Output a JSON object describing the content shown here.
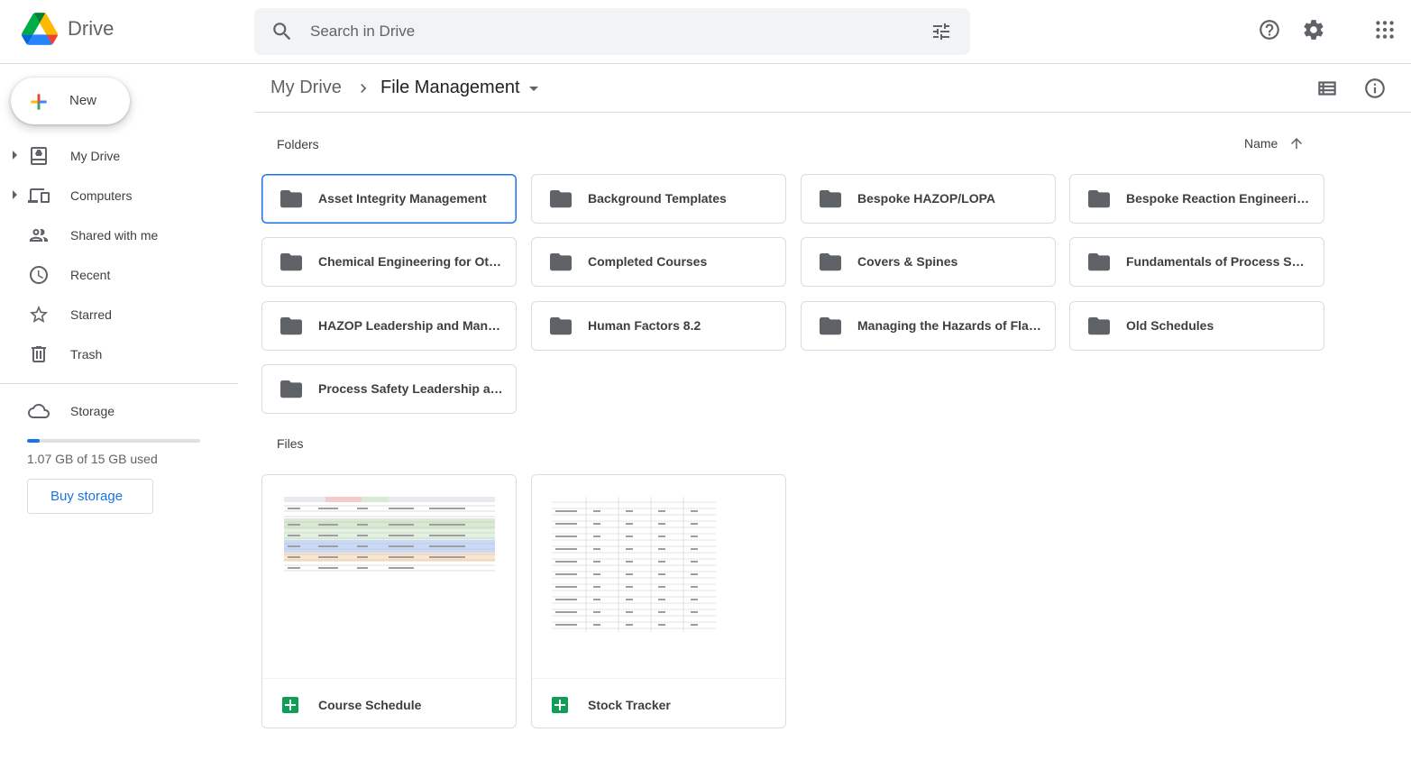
{
  "app": {
    "title": "Drive"
  },
  "search": {
    "placeholder": "Search in Drive"
  },
  "header": {
    "icons": [
      "help-icon",
      "settings-icon",
      "apps-grid-icon"
    ]
  },
  "sidebar": {
    "new_label": "New",
    "items": [
      {
        "label": "My Drive",
        "icon": "my-drive-icon",
        "expandable": true
      },
      {
        "label": "Computers",
        "icon": "computers-icon",
        "expandable": true
      },
      {
        "label": "Shared with me",
        "icon": "shared-icon",
        "expandable": false
      },
      {
        "label": "Recent",
        "icon": "clock-icon",
        "expandable": false
      },
      {
        "label": "Starred",
        "icon": "star-icon",
        "expandable": false
      },
      {
        "label": "Trash",
        "icon": "trash-icon",
        "expandable": false
      }
    ],
    "storage": {
      "label": "Storage",
      "used_text": "1.07 GB of 15 GB used",
      "used_fraction": 0.071,
      "buy_label": "Buy storage"
    }
  },
  "breadcrumb": {
    "root": "My Drive",
    "current": "File Management"
  },
  "sections": {
    "folders": "Folders",
    "files": "Files"
  },
  "sort": {
    "label": "Name",
    "direction": "ascending"
  },
  "folders": [
    {
      "name": "Asset Integrity Management",
      "selected": true
    },
    {
      "name": "Background Templates"
    },
    {
      "name": "Bespoke HAZOP/LOPA"
    },
    {
      "name": "Bespoke Reaction Engineering"
    },
    {
      "name": "Chemical Engineering for Othe..."
    },
    {
      "name": "Completed Courses"
    },
    {
      "name": "Covers & Spines"
    },
    {
      "name": "Fundamentals of Process Safe..."
    },
    {
      "name": "HAZOP Leadership and Mana..."
    },
    {
      "name": "Human Factors 8.2"
    },
    {
      "name": "Managing the Hazards of Flar..."
    },
    {
      "name": "Old Schedules"
    },
    {
      "name": "Process Safety Leadership an..."
    }
  ],
  "files": [
    {
      "name": "Course Schedule",
      "type": "spreadsheet"
    },
    {
      "name": "Stock Tracker",
      "type": "spreadsheet"
    }
  ],
  "colors": {
    "accent": "#1a73e8",
    "sheets_green": "#0f9d58",
    "folder_gray": "#5f6368"
  }
}
